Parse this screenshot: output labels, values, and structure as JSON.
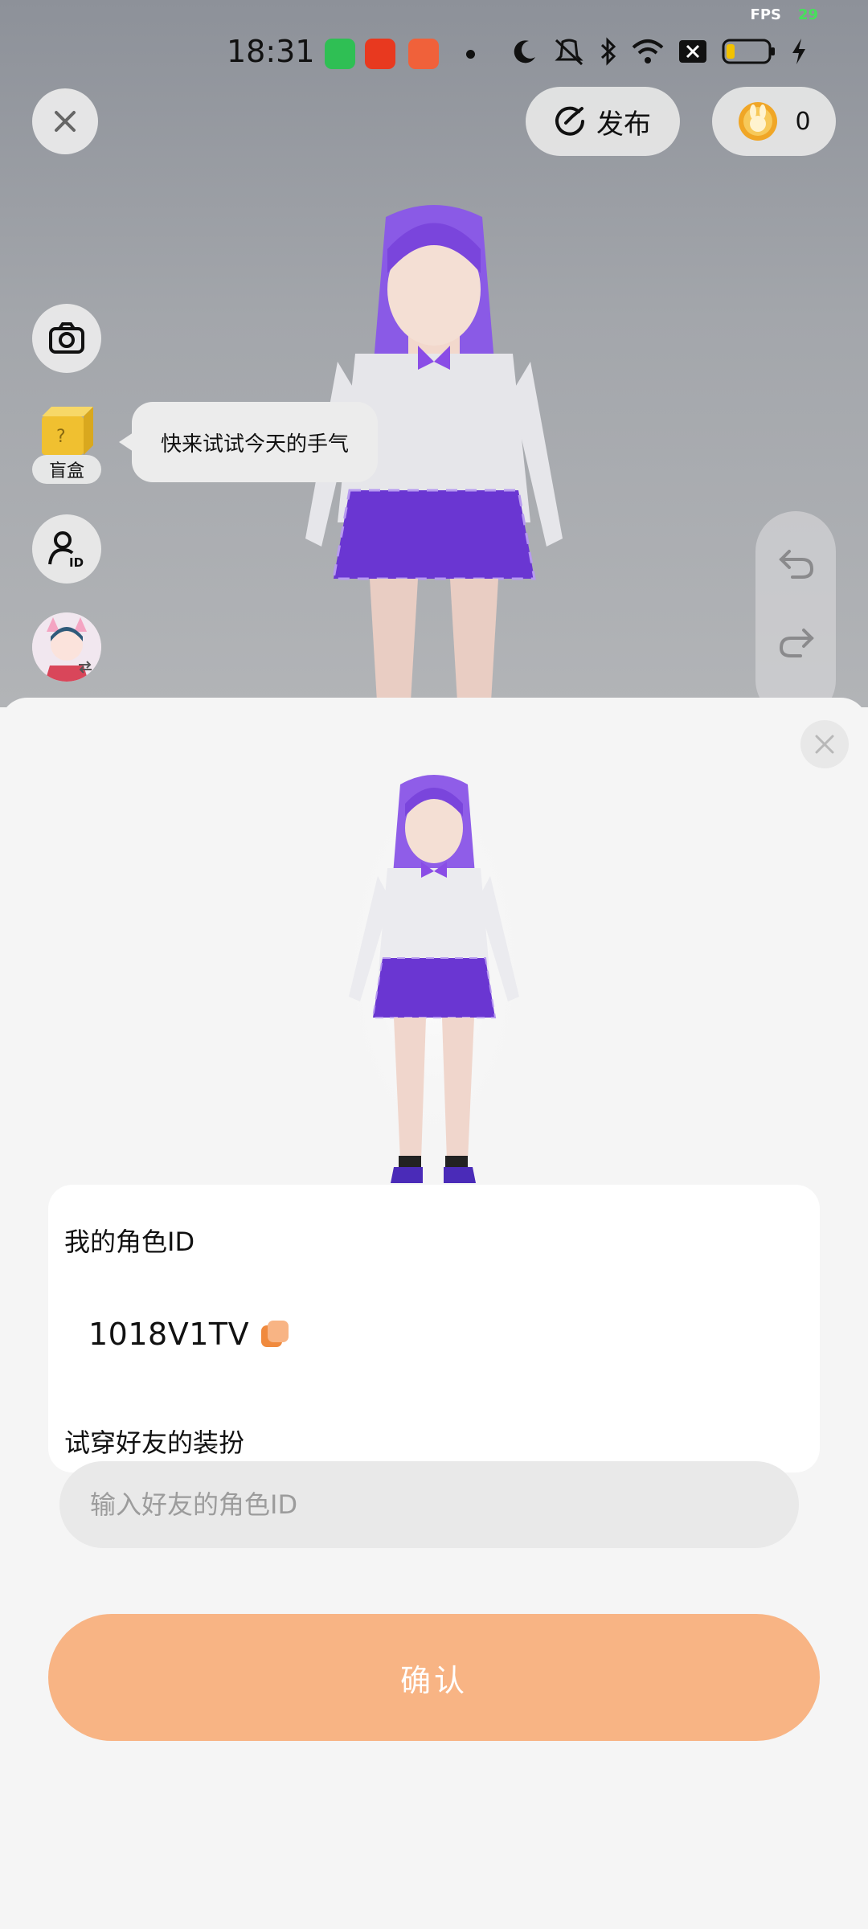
{
  "status_bar": {
    "time": "18:31",
    "fps_label": "FPS",
    "fps_value": "29"
  },
  "top_bar": {
    "publish_label": "发布",
    "coin_count": "0"
  },
  "left_toolbar": {
    "blind_box_label": "盲盒",
    "tip_text": "快来试试今天的手气"
  },
  "sheet": {
    "my_role_id_label": "我的角色ID",
    "my_role_id": "1018V1TV",
    "try_friend_label": "试穿好友的装扮",
    "friend_input_placeholder": "输入好友的角色ID",
    "friend_input_value": "",
    "confirm_label": "确认"
  },
  "colors": {
    "accent": "#f8b484",
    "copy_icon": "#f08a3e",
    "outfit_purple": "#7b3fd6"
  }
}
